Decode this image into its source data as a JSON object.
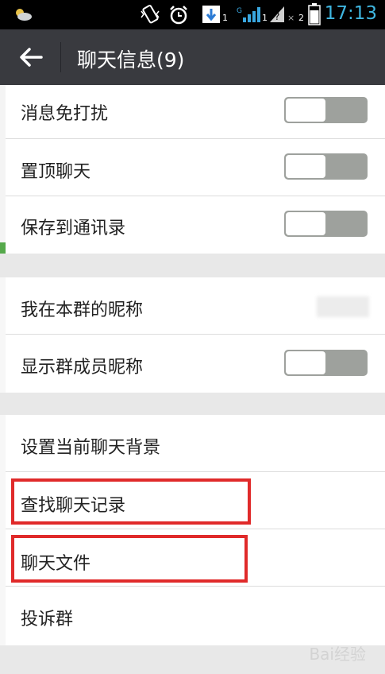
{
  "status_bar": {
    "time": "17:13",
    "icons": [
      "weather-icon",
      "vibrate-icon",
      "alarm-icon",
      "download-icon",
      "signal-icon",
      "no-sim-icon",
      "battery-icon"
    ],
    "sim_labels": [
      "1",
      "1",
      "2"
    ]
  },
  "header": {
    "title": "聊天信息(9)",
    "back_icon": "arrow-left-icon",
    "background": "#393a3f"
  },
  "groups": [
    {
      "rows": [
        {
          "label": "消息免打扰",
          "toggle": false
        },
        {
          "label": "置顶聊天",
          "toggle": false
        },
        {
          "label": "保存到通讯录",
          "toggle": false
        }
      ]
    },
    {
      "rows": [
        {
          "label": "我在本群的昵称",
          "value_hidden": true
        },
        {
          "label": "显示群成员昵称",
          "toggle": false
        }
      ]
    },
    {
      "rows": [
        {
          "label": "设置当前聊天背景"
        },
        {
          "label": "查找聊天记录",
          "highlighted": true
        },
        {
          "label": "聊天文件",
          "highlighted": true
        },
        {
          "label": "投诉群"
        }
      ]
    }
  ],
  "colors": {
    "highlight": "#e02a2a",
    "toggle_off": "#9ea19d",
    "page_background": "#e8e8e8"
  },
  "watermark": "Bai经验"
}
